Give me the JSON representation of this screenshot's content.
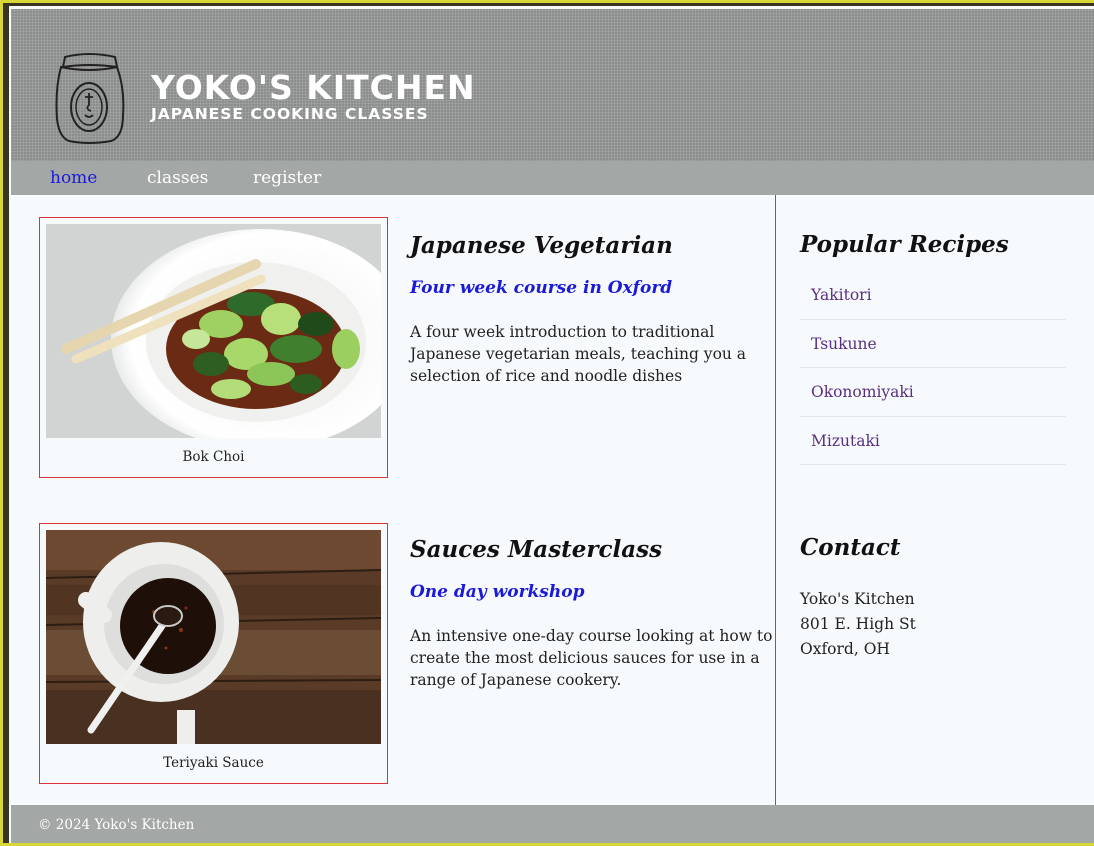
{
  "brand": {
    "title": "YOKO'S KITCHEN",
    "subtitle": "JAPANESE COOKING CLASSES",
    "logo_icon": "tea-caddy-logo-icon"
  },
  "nav": {
    "items": [
      {
        "label": "home",
        "current": true
      },
      {
        "label": "classes",
        "current": false
      },
      {
        "label": "register",
        "current": false
      }
    ]
  },
  "courses": [
    {
      "image_caption": "Bok Choi",
      "title": "Japanese Vegetarian",
      "subtitle": "Four week course in Oxford",
      "description": "A four week introduction to traditional Japanese vegetarian meals, teaching you a selection of rice and noodle dishes"
    },
    {
      "image_caption": "Teriyaki Sauce",
      "title": "Sauces Masterclass",
      "subtitle": "One day workshop",
      "description": "An intensive one-day course looking at how to create the most delicious sauces for use in a range of Japanese cookery."
    }
  ],
  "sidebar": {
    "recipes_title": "Popular Recipes",
    "recipes": [
      "Yakitori",
      "Tsukune",
      "Okonomiyaki",
      "Mizutaki"
    ],
    "contact_title": "Contact",
    "address": [
      "Yoko's Kitchen",
      "801 E. High St",
      "Oxford, OH"
    ]
  },
  "footer": {
    "copyright": "© 2024 Yoko's Kitchen"
  },
  "colors": {
    "accent_link": "#1a1ad8",
    "recipe_link": "#5a2e80",
    "figure_border": "#d9343a",
    "column_divider": "#2e8b3c",
    "bar_gray": "#a3a7a6"
  }
}
